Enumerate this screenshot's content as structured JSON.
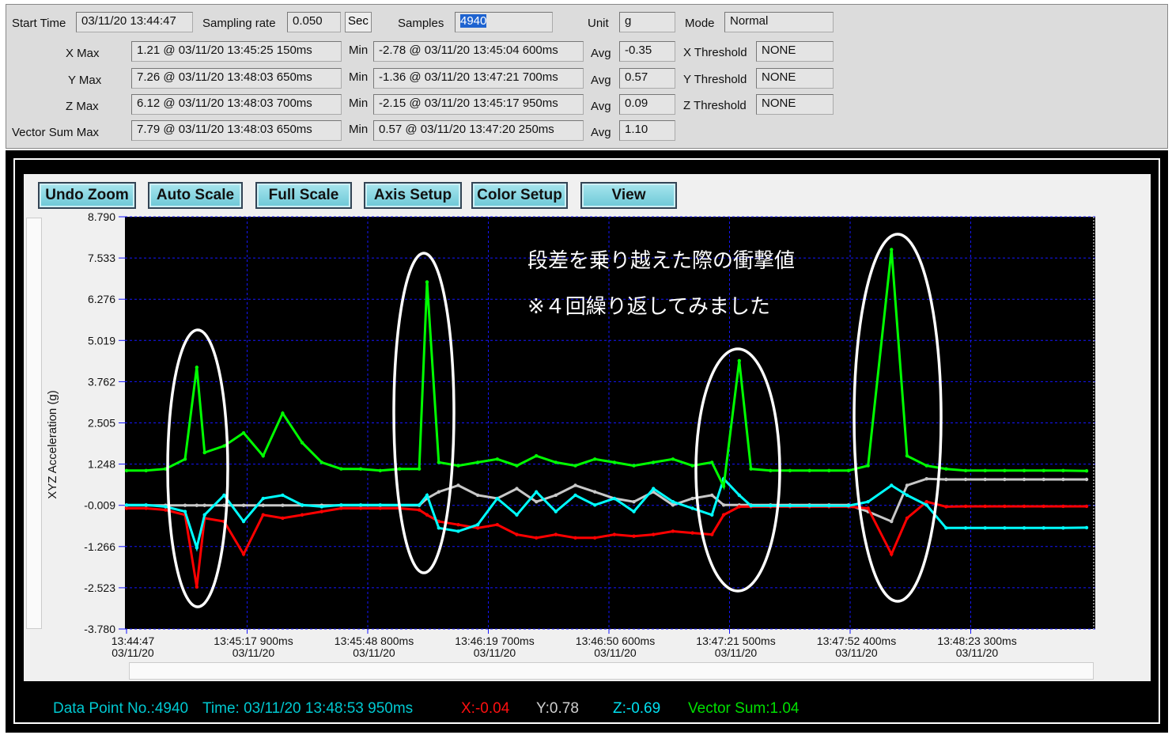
{
  "header": {
    "start_time_label": "Start Time",
    "start_time": "03/11/20 13:44:47",
    "sampling_rate_label": "Sampling rate",
    "sampling_rate": "0.050",
    "sampling_unit_button": "Sec",
    "samples_label": "Samples",
    "samples": "4940",
    "unit_label": "Unit",
    "unit": "g",
    "mode_label": "Mode",
    "mode": "Normal",
    "min_label": "Min",
    "avg_label": "Avg",
    "rows": [
      {
        "label": "X  Max",
        "max": "1.21 @ 03/11/20 13:45:25 150ms",
        "min": "-2.78 @ 03/11/20 13:45:04 600ms",
        "avg": "-0.35",
        "threshold_label": "X Threshold",
        "threshold": "NONE"
      },
      {
        "label": "Y Max",
        "max": "7.26 @ 03/11/20 13:48:03 650ms",
        "min": "-1.36 @ 03/11/20 13:47:21 700ms",
        "avg": "0.57",
        "threshold_label": "Y Threshold",
        "threshold": "NONE"
      },
      {
        "label": "Z  Max",
        "max": "6.12 @ 03/11/20 13:48:03 700ms",
        "min": "-2.15 @ 03/11/20 13:45:17 950ms",
        "avg": "0.09",
        "threshold_label": "Z Threshold",
        "threshold": "NONE"
      },
      {
        "label": "Vector Sum Max",
        "max": "7.79 @ 03/11/20 13:48:03 650ms",
        "min": "0.57 @ 03/11/20 13:47:20 250ms",
        "avg": "1.10"
      }
    ]
  },
  "toolbar": [
    "Undo Zoom",
    "Auto Scale",
    "Full Scale",
    "Axis Setup",
    "Color Setup",
    "View"
  ],
  "status": {
    "point": "Data Point No.:4940",
    "time": "Time: 03/11/20 13:48:53 950ms",
    "x": "X:-0.04",
    "y": "Y:0.78",
    "z": "Z:-0.69",
    "vector": "Vector Sum:1.04"
  },
  "chart_data": {
    "type": "line",
    "ylabel": "XYZ  Acceleration (g)",
    "ylim": [
      -3.78,
      8.79
    ],
    "yticks": [
      "8.790",
      "7.533",
      "6.276",
      "5.019",
      "3.762",
      "2.505",
      "1.248",
      "-0.009",
      "-1.266",
      "-2.523",
      "-3.780"
    ],
    "xticks": [
      [
        "13:44:47",
        "03/11/20"
      ],
      [
        "13:45:17 900ms",
        "03/11/20"
      ],
      [
        "13:45:48 800ms",
        "03/11/20"
      ],
      [
        "13:46:19 700ms",
        "03/11/20"
      ],
      [
        "13:46:50 600ms",
        "03/11/20"
      ],
      [
        "13:47:21 500ms",
        "03/11/20"
      ],
      [
        "13:47:52 400ms",
        "03/11/20"
      ],
      [
        "13:48:23 300ms",
        "03/11/20"
      ]
    ],
    "grid": true,
    "background": "#000000",
    "annotations": [
      "段差を乗り越えた際の衝撃値",
      "※４回繰り返してみました"
    ],
    "x": [
      "13:44:47",
      "13:44:52",
      "13:44:57",
      "13:45:02",
      "13:45:05",
      "13:45:07",
      "13:45:12",
      "13:45:17",
      "13:45:22",
      "13:45:27",
      "13:45:32",
      "13:45:37",
      "13:45:42",
      "13:45:47",
      "13:45:52",
      "13:45:57",
      "13:46:02",
      "13:46:04",
      "13:46:07",
      "13:46:12",
      "13:46:17",
      "13:46:22",
      "13:46:27",
      "13:46:32",
      "13:46:37",
      "13:46:42",
      "13:46:47",
      "13:46:52",
      "13:46:57",
      "13:47:02",
      "13:47:07",
      "13:47:12",
      "13:47:17",
      "13:47:20",
      "13:47:24",
      "13:47:27",
      "13:47:32",
      "13:47:37",
      "13:47:42",
      "13:47:47",
      "13:47:52",
      "13:47:57",
      "13:48:03",
      "13:48:07",
      "13:48:12",
      "13:48:17",
      "13:48:22",
      "13:48:27",
      "13:48:32",
      "13:48:37",
      "13:48:42",
      "13:48:47",
      "13:48:53"
    ],
    "series": [
      {
        "name": "Y",
        "color": "#c8c8c8",
        "values": [
          -0.01,
          -0.01,
          -0.01,
          -0.01,
          -0.01,
          -0.01,
          -0.01,
          -0.01,
          -0.01,
          -0.01,
          -0.01,
          -0.01,
          -0.01,
          -0.01,
          -0.01,
          -0.01,
          -0.01,
          0.2,
          0.4,
          0.6,
          0.3,
          0.2,
          0.5,
          0.1,
          0.3,
          0.6,
          0.4,
          0.2,
          0.1,
          0.4,
          0.0,
          0.2,
          0.3,
          0.0,
          0.0,
          0.0,
          0.0,
          0.0,
          0.0,
          0.0,
          0.0,
          -0.2,
          -0.5,
          0.6,
          0.8,
          0.78,
          0.78,
          0.78,
          0.78,
          0.78,
          0.78,
          0.78,
          0.78
        ]
      },
      {
        "name": "X",
        "color": "#ff0000",
        "values": [
          -0.1,
          -0.1,
          -0.15,
          -0.3,
          -2.5,
          -0.4,
          -0.5,
          -1.5,
          -0.3,
          -0.4,
          -0.3,
          -0.2,
          -0.1,
          -0.1,
          -0.1,
          -0.1,
          -0.15,
          -0.3,
          -0.5,
          -0.6,
          -0.7,
          -0.6,
          -0.9,
          -1.0,
          -0.9,
          -1.0,
          -1.0,
          -0.9,
          -0.95,
          -0.9,
          -0.8,
          -0.85,
          -0.9,
          -0.3,
          -0.05,
          -0.05,
          -0.05,
          -0.05,
          -0.05,
          -0.05,
          -0.05,
          -0.1,
          -1.5,
          -0.4,
          0.1,
          -0.05,
          -0.04,
          -0.04,
          -0.04,
          -0.04,
          -0.04,
          -0.04,
          -0.04
        ]
      },
      {
        "name": "Z",
        "color": "#00ffff",
        "values": [
          0.0,
          0.0,
          -0.05,
          -0.2,
          -1.3,
          -0.3,
          0.3,
          -0.5,
          0.2,
          0.3,
          0.0,
          -0.05,
          0.0,
          0.0,
          0.0,
          0.0,
          0.0,
          0.3,
          -0.7,
          -0.8,
          -0.6,
          0.2,
          -0.3,
          0.4,
          -0.2,
          0.3,
          0.0,
          0.2,
          -0.2,
          0.5,
          0.1,
          -0.1,
          -0.3,
          0.8,
          0.3,
          -0.02,
          -0.02,
          -0.02,
          -0.02,
          -0.02,
          -0.02,
          0.1,
          0.6,
          0.3,
          0.0,
          -0.7,
          -0.7,
          -0.7,
          -0.7,
          -0.7,
          -0.7,
          -0.7,
          -0.69
        ]
      },
      {
        "name": "Vector Sum",
        "color": "#00ff00",
        "values": [
          1.05,
          1.05,
          1.1,
          1.4,
          4.2,
          1.6,
          1.8,
          2.2,
          1.5,
          2.8,
          1.9,
          1.3,
          1.1,
          1.1,
          1.05,
          1.1,
          1.1,
          6.8,
          1.3,
          1.2,
          1.3,
          1.4,
          1.2,
          1.5,
          1.3,
          1.2,
          1.4,
          1.3,
          1.2,
          1.3,
          1.4,
          1.2,
          1.3,
          0.57,
          4.4,
          1.1,
          1.05,
          1.05,
          1.05,
          1.05,
          1.05,
          1.2,
          7.79,
          1.5,
          1.2,
          1.1,
          1.05,
          1.05,
          1.05,
          1.05,
          1.05,
          1.05,
          1.04
        ]
      }
    ]
  }
}
